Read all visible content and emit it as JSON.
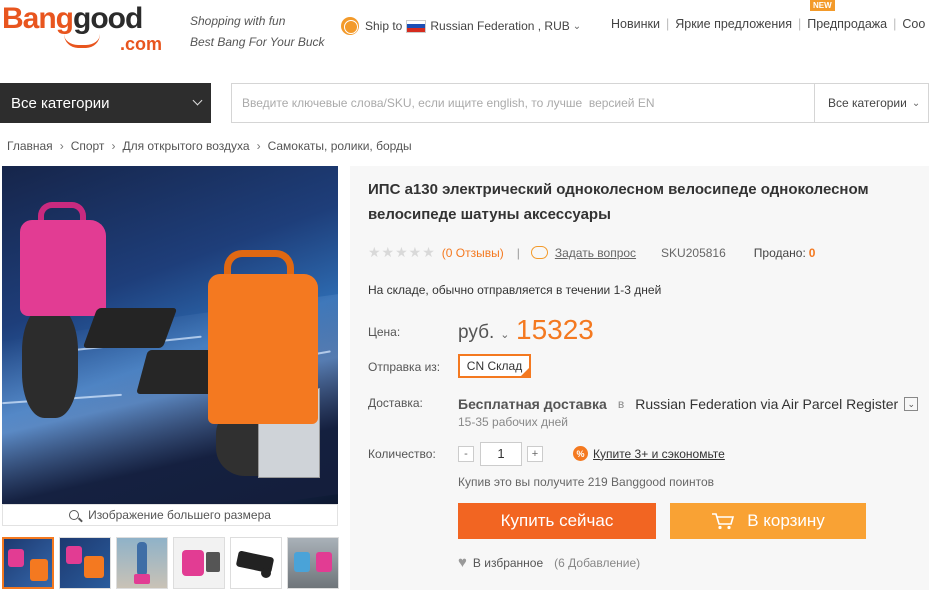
{
  "header": {
    "logo_bang": "Bang",
    "logo_good": "good",
    "logo_com": ".com",
    "slogan_line1": "Shopping with fun",
    "slogan_line2": "Best Bang For Your Buck",
    "ship_to_label": "Ship to",
    "ship_to_value": "Russian Federation , RUB",
    "nav": [
      "Новинки",
      "Яркие предложения",
      "Предпродажа",
      "Coo"
    ],
    "new_badge": "NEW"
  },
  "search": {
    "category_button": "Все категории",
    "placeholder": "Введите ключевые слова/SKU, если ищите english, то лучше  версией EN",
    "category_select": "Все категории"
  },
  "breadcrumb": [
    "Главная",
    "Спорт",
    "Для открытого воздуха",
    "Самокаты, ролики, борды"
  ],
  "gallery": {
    "caption": "Изображение большего размера",
    "thumb_count": 6
  },
  "product": {
    "title": "ИПС а130 электрический одноколесном велосипеде одноколесном велосипеде шатуны аксессуары",
    "stars": "★★★★★",
    "reviews": "(0 Отзывы)",
    "divider": "|",
    "ask": "Задать вопрос",
    "sku": "SKU205816",
    "sold_label": "Продано:",
    "sold_value": "0",
    "stock": "На складе, обычно отправляется в течении 1-3 дней",
    "price_label": "Цена:",
    "currency": "руб.",
    "price": "15323",
    "ship_from_label": "Отправка из:",
    "warehouse": "CN Склад",
    "delivery_label": "Доставка:",
    "delivery_free": "Бесплатная доставка",
    "delivery_in": "в",
    "delivery_method": "Russian Federation via Air Parcel Register",
    "delivery_days": "15-35 рабочих дней",
    "qty_label": "Количество:",
    "qty_value": "1",
    "minus": "-",
    "plus": "+",
    "save_link": "Купите 3+ и сэкономьте",
    "points": "Купив это вы получите 219 Banggood поинтов",
    "buy_now": "Купить сейчас",
    "add_to_cart": "В корзину",
    "wishlist": "В избранное",
    "wishlist_count": "(6 Добавление)"
  },
  "colors": {
    "accent": "#f47920",
    "buy": "#f26522",
    "cart": "#f9a234",
    "dark": "#2d2d2d"
  }
}
